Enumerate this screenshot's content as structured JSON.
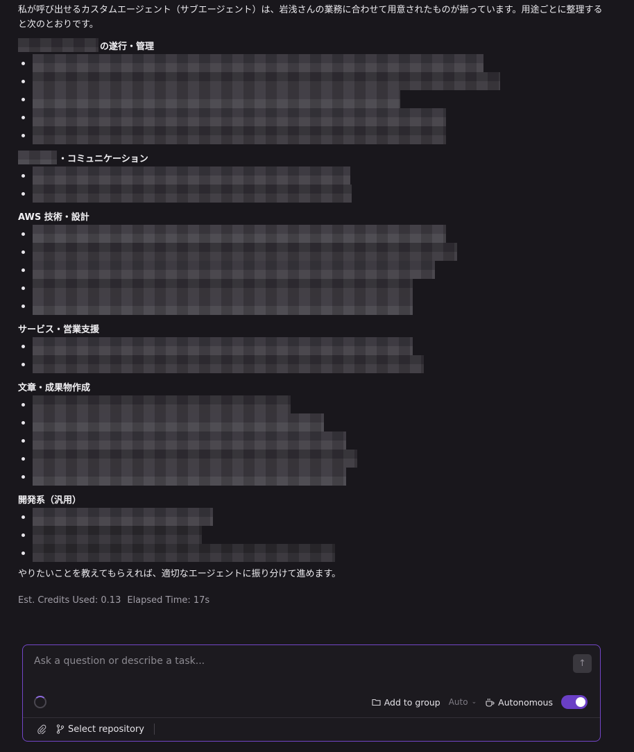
{
  "chat": {
    "intro": "私が呼び出せるカスタムエージェント（サブエージェント）は、岩浅さんの業務に合わせて用意されたものが揃っています。用途ごとに整理すると次のとおりです。",
    "sections": [
      {
        "title": "の遂行・管理",
        "has_redacted_prefix": true,
        "item_count": 5
      },
      {
        "title": "・コミュニケーション",
        "has_redacted_prefix": true,
        "item_count": 2
      },
      {
        "title": "AWS 技術・設計",
        "has_redacted_prefix": false,
        "item_count": 5
      },
      {
        "title": "サービス・営業支援",
        "has_redacted_prefix": false,
        "item_count": 2
      },
      {
        "title": "文章・成果物作成",
        "has_redacted_prefix": false,
        "item_count": 5
      },
      {
        "title": "開発系（汎用）",
        "has_redacted_prefix": false,
        "item_count": 3
      }
    ],
    "closing": "やりたいことを教えてもらえれば、適切なエージェントに振り分けて進めます。",
    "credits_label": "Est. Credits Used: 0.13",
    "elapsed_label": "Elapsed Time: 17s"
  },
  "composer": {
    "placeholder": "Ask a question or describe a task...",
    "add_to_group": "Add to group",
    "mode": "Auto",
    "autonomous_label": "Autonomous",
    "autonomous_on": true,
    "select_repository": "Select repository"
  },
  "icons": {
    "send": "arrow-up-icon",
    "folder": "folder-icon",
    "chevron": "chevron-down-icon",
    "autonomous": "coffee-cup-icon",
    "attach": "paperclip-icon",
    "branch": "git-branch-icon"
  },
  "colors": {
    "background": "#19171c",
    "accent": "#7346c7",
    "toggle": "#6a3fc5"
  }
}
